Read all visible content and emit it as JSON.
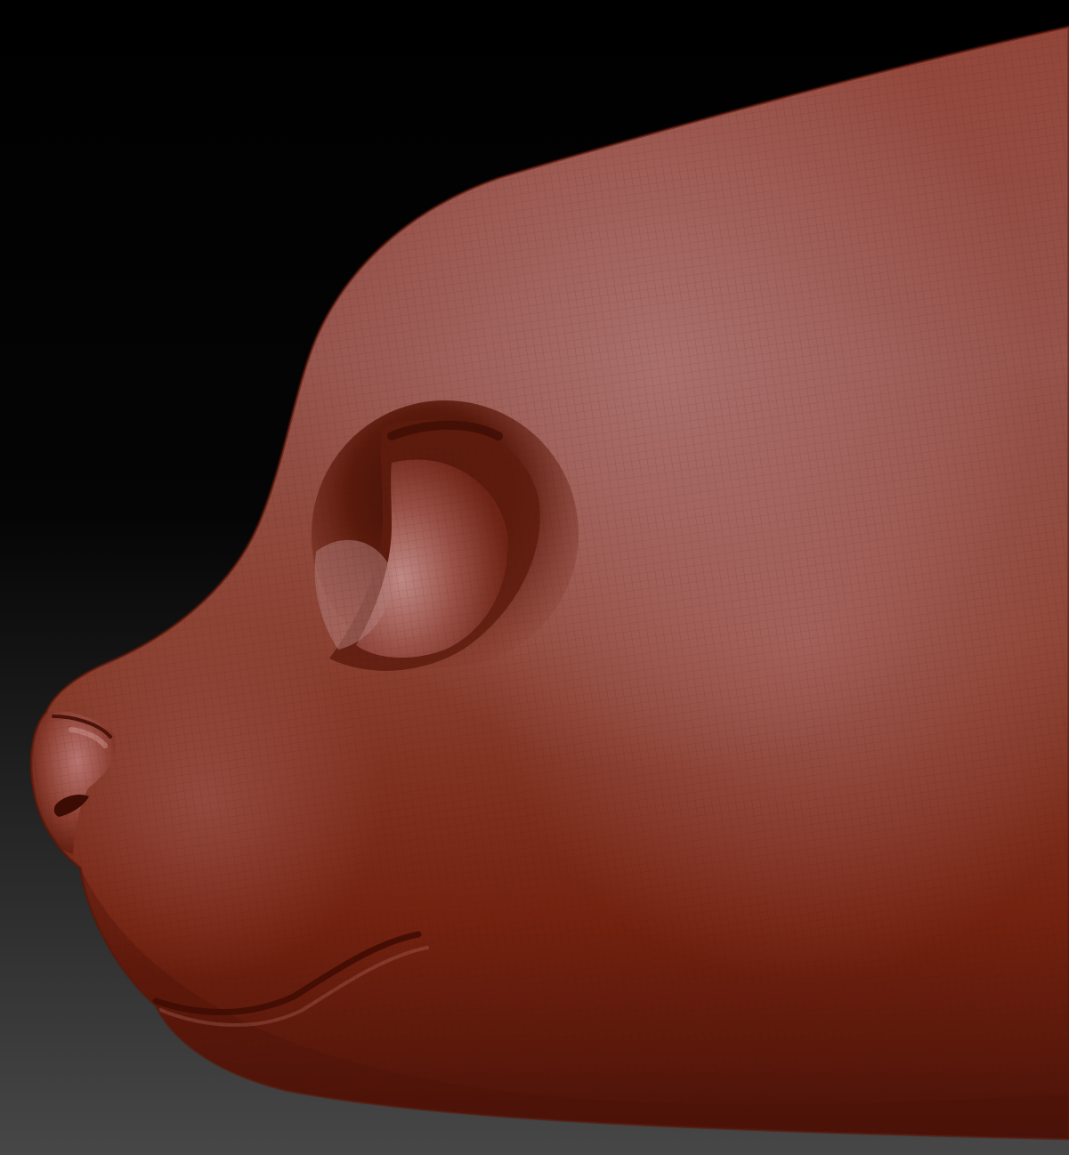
{
  "scene": {
    "subject": "sculpted-animal-head-profile",
    "colors": {
      "background_top": "#000000",
      "background_bottom": "#474747",
      "clay_highlight": "#a86a68",
      "clay_mid": "#8a3a2c",
      "clay_shadow": "#4a1208",
      "mesh_line": "#3a0f08"
    }
  }
}
